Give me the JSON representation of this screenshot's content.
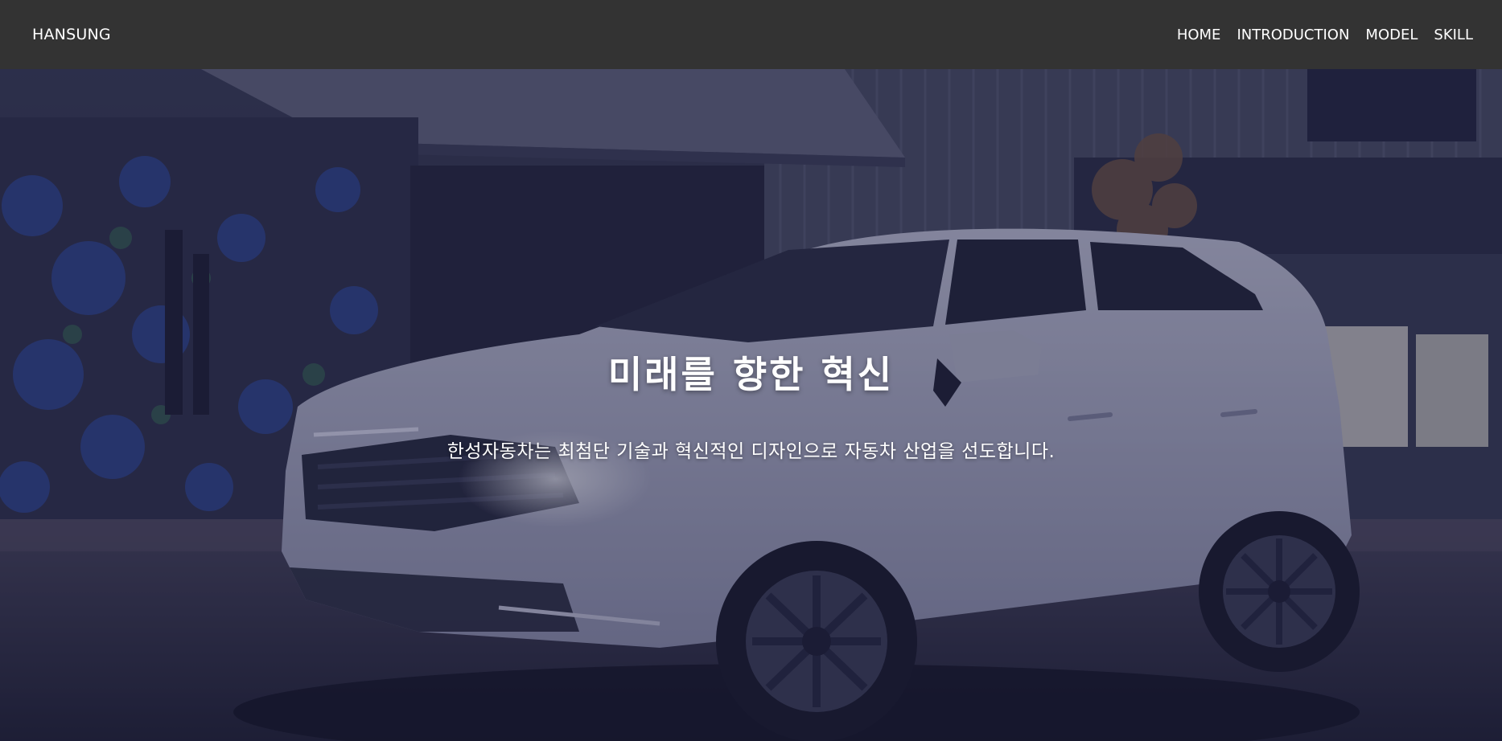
{
  "navbar": {
    "brand": "HANSUNG",
    "links": [
      "HOME",
      "INTRODUCTION",
      "MODEL",
      "SKILL"
    ]
  },
  "hero": {
    "title": "미래를 향한 혁신",
    "subtitle": "한성자동차는 최첨단 기술과 혁신적인 디자인으로 자동차 산업을 선도합니다.",
    "image": "white-suv-in-front-of-building"
  },
  "colors": {
    "navbar_bg": "#333333",
    "text": "#ffffff",
    "overlay": "#1c1e42"
  }
}
